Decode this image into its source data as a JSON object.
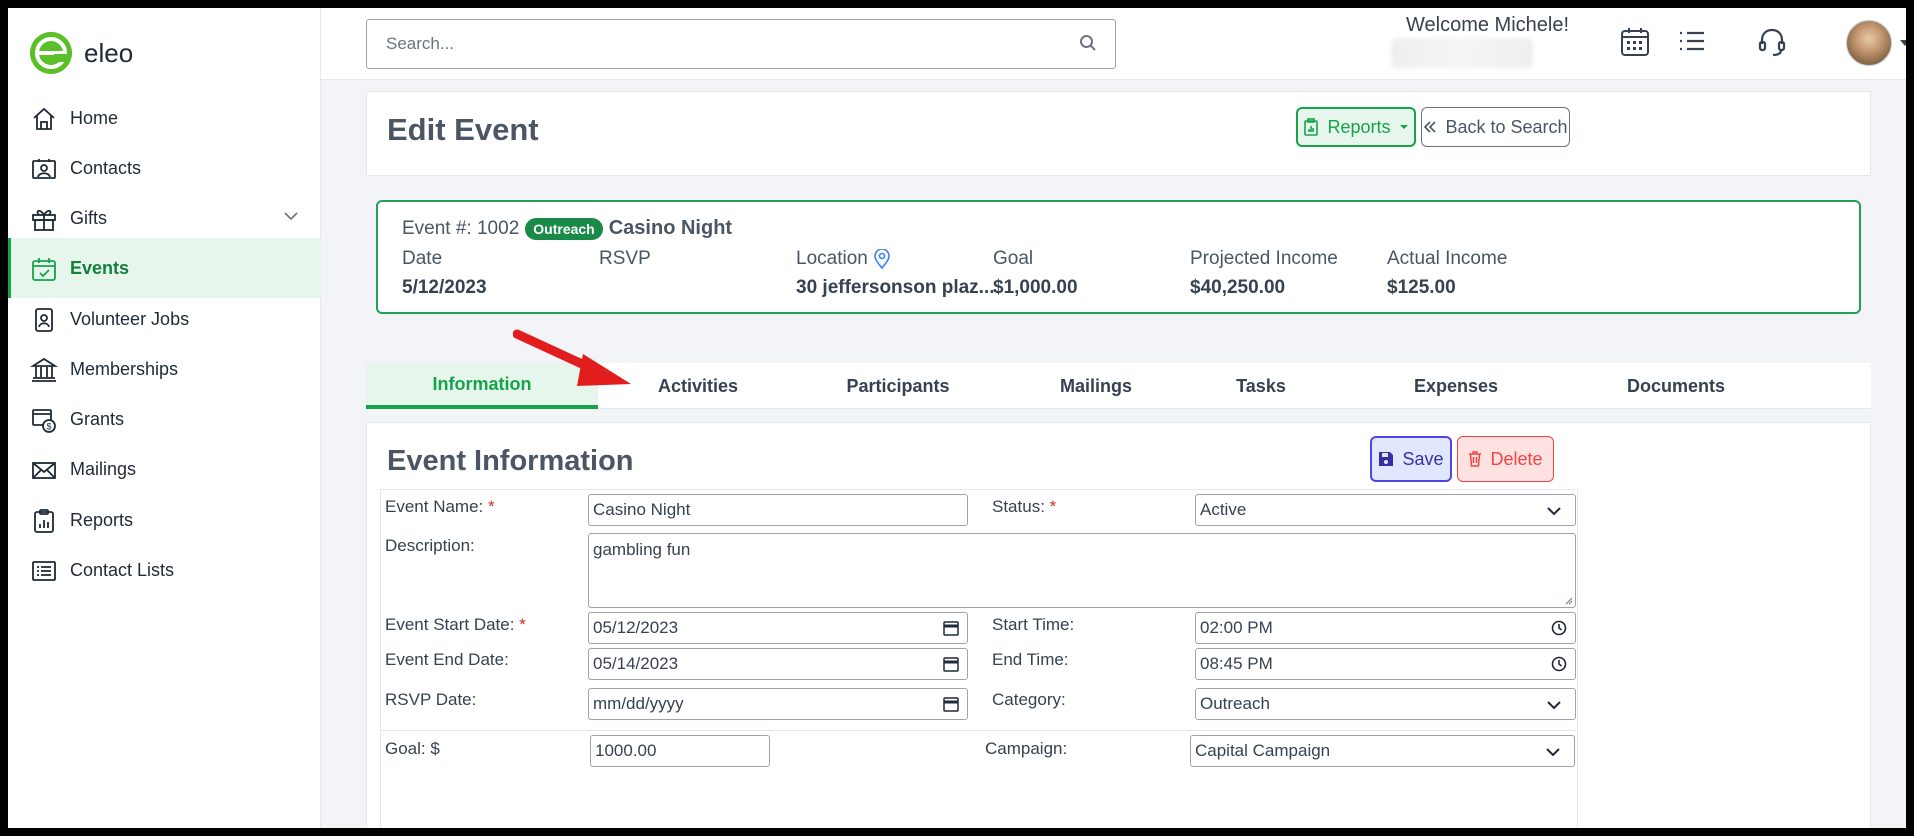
{
  "app": {
    "name": "eleo"
  },
  "sidebar": {
    "items": [
      {
        "label": "Home",
        "icon": "home-icon"
      },
      {
        "label": "Contacts",
        "icon": "contacts-icon"
      },
      {
        "label": "Gifts",
        "icon": "gift-icon",
        "expandable": true
      },
      {
        "label": "Events",
        "icon": "calendar-check-icon",
        "active": true
      },
      {
        "label": "Volunteer Jobs",
        "icon": "badge-icon"
      },
      {
        "label": "Memberships",
        "icon": "bank-icon"
      },
      {
        "label": "Grants",
        "icon": "grants-icon"
      },
      {
        "label": "Mailings",
        "icon": "envelope-icon"
      },
      {
        "label": "Reports",
        "icon": "report-icon"
      },
      {
        "label": "Contact Lists",
        "icon": "list-icon"
      }
    ]
  },
  "header": {
    "search_placeholder": "Search...",
    "welcome": "Welcome Michele!"
  },
  "page": {
    "title": "Edit Event",
    "reports_label": "Reports",
    "back_label": "Back to Search"
  },
  "summary": {
    "event_number": "Event #: 1002",
    "badge": "Outreach",
    "name": "Casino Night",
    "date_label": "Date",
    "date_value": "5/12/2023",
    "rsvp_label": "RSVP",
    "rsvp_value": "",
    "location_label": "Location",
    "location_value": "30 jeffersonson plaz...",
    "goal_label": "Goal",
    "goal_value": "$1,000.00",
    "projected_label": "Projected Income",
    "projected_value": "$40,250.00",
    "actual_label": "Actual Income",
    "actual_value": "$125.00"
  },
  "tabs": [
    "Information",
    "Activities",
    "Participants",
    "Mailings",
    "Tasks",
    "Expenses",
    "Documents"
  ],
  "form": {
    "section_title": "Event Information",
    "save_label": "Save",
    "delete_label": "Delete",
    "event_name_label": "Event Name:",
    "event_name_value": "Casino Night",
    "status_label": "Status:",
    "status_value": "Active",
    "description_label": "Description:",
    "description_value": "gambling fun",
    "start_date_label": "Event Start Date:",
    "start_date_value": "05/12/2023",
    "start_time_label": "Start Time:",
    "start_time_value": "02:00  PM",
    "end_date_label": "Event End Date:",
    "end_date_value": "05/14/2023",
    "end_time_label": "End Time:",
    "end_time_value": "08:45  PM",
    "rsvp_date_label": "RSVP Date:",
    "rsvp_date_placeholder": "mm/dd/yyyy",
    "category_label": "Category:",
    "category_value": "Outreach",
    "goal_label": "Goal: $",
    "goal_value": "1000.00",
    "campaign_label": "Campaign:",
    "campaign_value": "Capital Campaign",
    "required_mark": "*"
  },
  "colors": {
    "brand_green": "#16a34a",
    "annotation_arrow": "#e11d1d"
  }
}
